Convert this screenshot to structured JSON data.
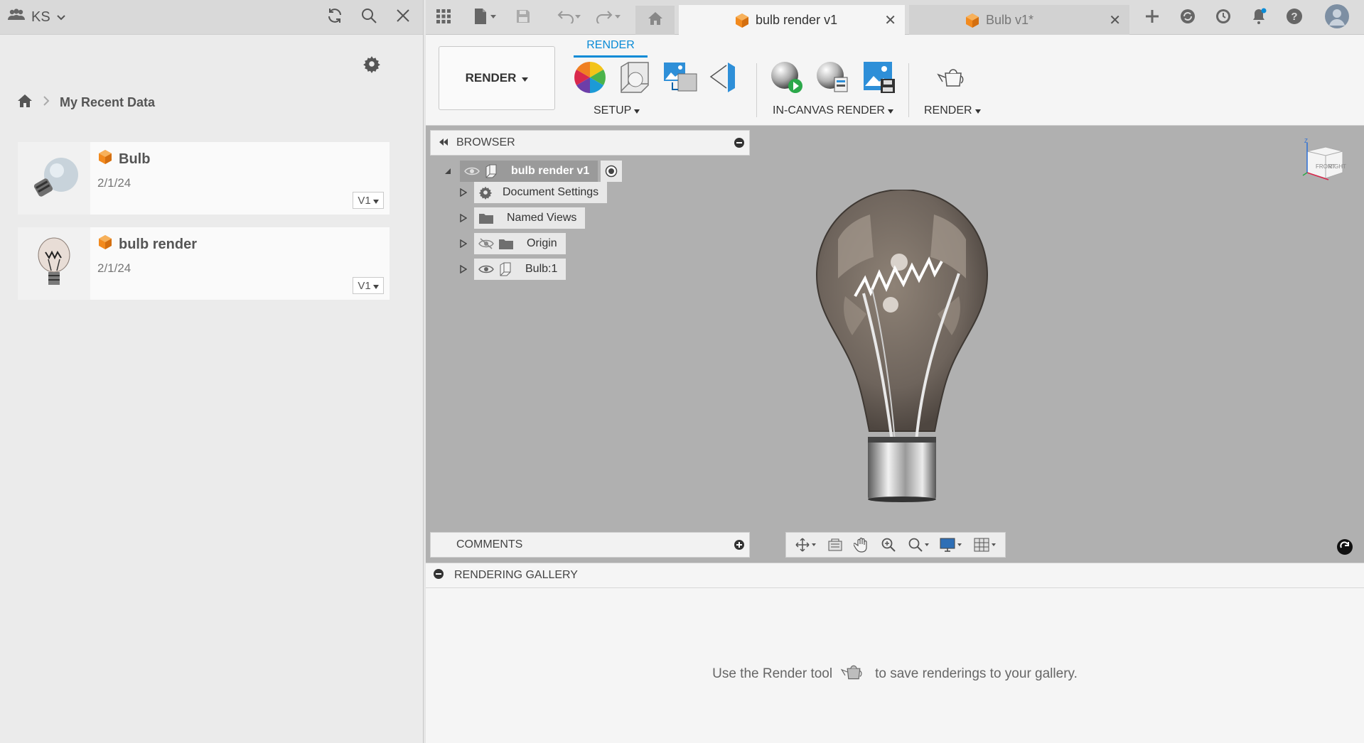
{
  "left_panel": {
    "team_label": "KS",
    "breadcrumb": "My Recent Data",
    "files": [
      {
        "name": "Bulb",
        "date": "2/1/24",
        "version": "V1"
      },
      {
        "name": "bulb render",
        "date": "2/1/24",
        "version": "V1"
      }
    ]
  },
  "tabs": {
    "active": {
      "label": "bulb render v1",
      "close": "✕"
    },
    "inactive": {
      "label": "Bulb v1*",
      "close": "✕"
    }
  },
  "toolbar": {
    "workspace_label": "RENDER",
    "ribbon_tab": "RENDER",
    "groups": {
      "setup": "SETUP",
      "in_canvas": "IN-CANVAS RENDER",
      "render": "RENDER"
    }
  },
  "browser": {
    "title": "BROWSER",
    "root": "bulb render v1",
    "items": [
      {
        "label": "Document Settings",
        "icon": "gear-icon"
      },
      {
        "label": "Named Views",
        "icon": "folder-icon"
      },
      {
        "label": "Origin",
        "icon": "folder-icon",
        "visibility": "hidden"
      },
      {
        "label": "Bulb:1",
        "icon": "component-icon",
        "visibility": "visible"
      }
    ]
  },
  "comments": {
    "title": "COMMENTS"
  },
  "gallery": {
    "title": "RENDERING GALLERY",
    "message_before": "Use the Render tool",
    "message_after": "to save renderings to your gallery."
  },
  "colors": {
    "accent": "#0a8bd6",
    "brand_orange": "#f28a1e",
    "viewport_bg": "#b0b0b0"
  }
}
